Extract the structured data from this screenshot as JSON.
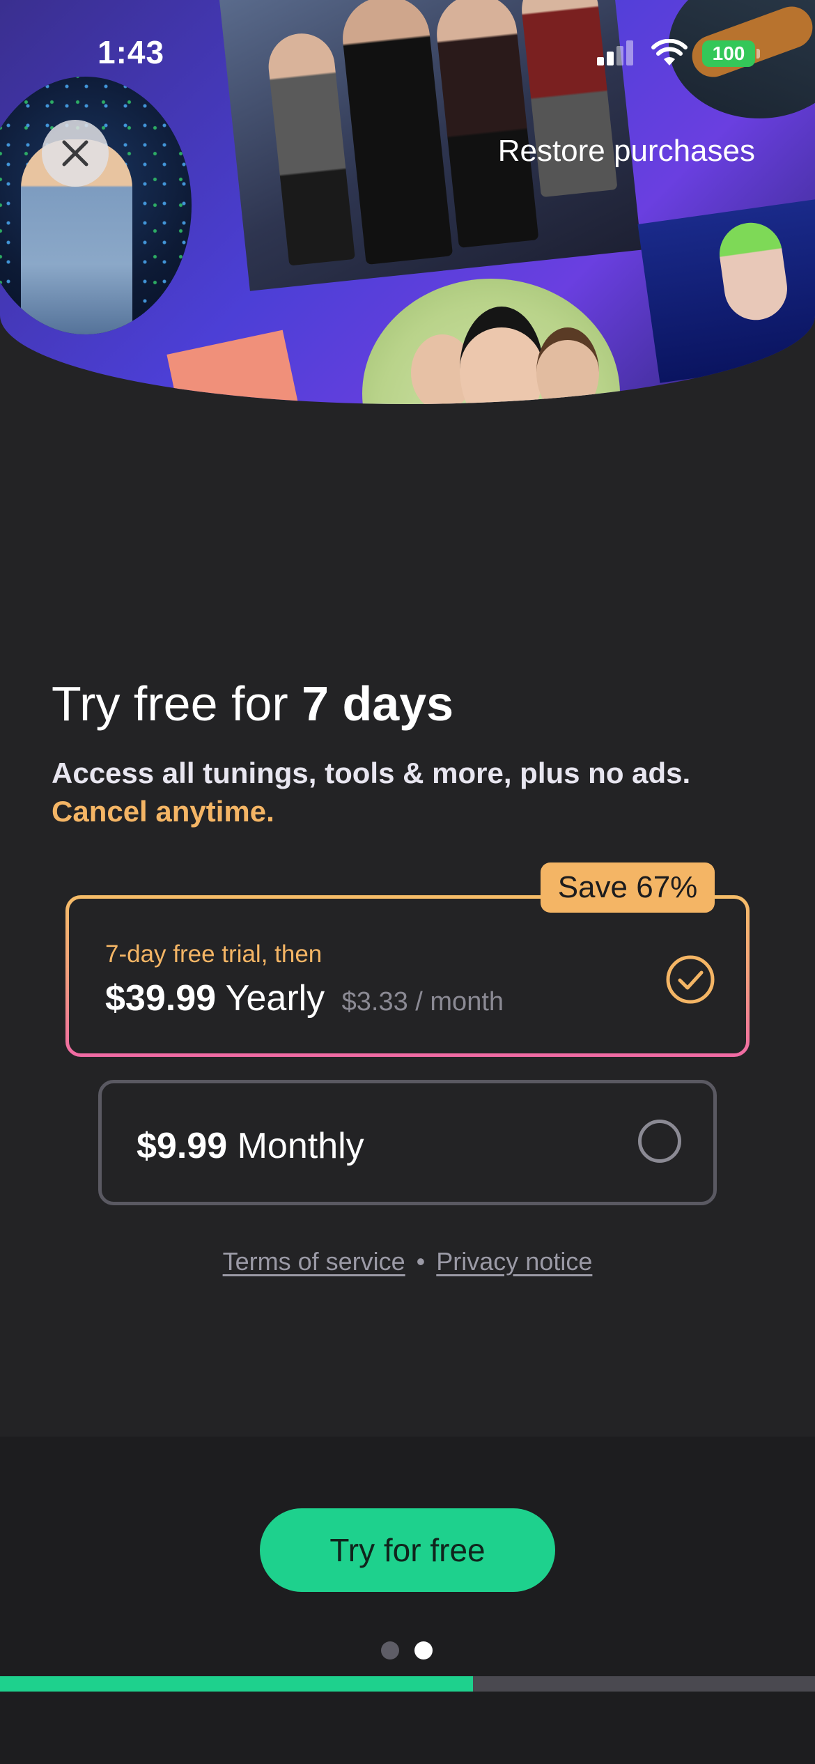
{
  "status_bar": {
    "time": "1:43",
    "battery": "100"
  },
  "header": {
    "restore_label": "Restore purchases"
  },
  "offer": {
    "headline_prefix": "Try free for ",
    "headline_bold": "7 days",
    "subtitle": "Access all tunings, tools & more, plus no ads.",
    "cancel_note": "Cancel anytime."
  },
  "plans": {
    "yearly": {
      "badge": "Save 67%",
      "trial_label": "7-day free trial, then",
      "price": "$39.99",
      "period": "Yearly",
      "per_month": "$3.33 / month",
      "selected": true
    },
    "monthly": {
      "price": "$9.99",
      "period": "Monthly",
      "selected": false
    }
  },
  "legal": {
    "terms": "Terms of service",
    "separator": "•",
    "privacy": "Privacy notice"
  },
  "cta": {
    "label": "Try for free"
  },
  "pager": {
    "pages": 2,
    "current": 2
  },
  "progress": {
    "fraction": 0.58
  },
  "colors": {
    "accent_orange": "#f4b565",
    "accent_pink": "#f06aa4",
    "cta_green": "#1ed18d",
    "background": "#232325"
  }
}
